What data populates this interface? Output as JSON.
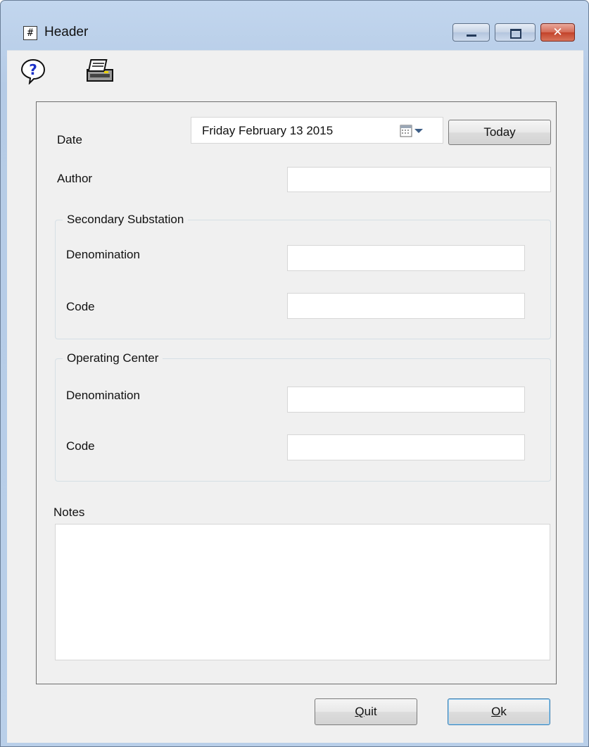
{
  "window": {
    "title": "Header"
  },
  "toolbar": {
    "help_icon": "help-question-icon",
    "print_icon": "printer-icon"
  },
  "form": {
    "date_label": "Date",
    "date_value": "Friday February 13 2015",
    "today_button": "Today",
    "author_label": "Author",
    "author_value": "",
    "secondary_substation": {
      "title": "Secondary Substation",
      "denomination_label": "Denomination",
      "denomination_value": "",
      "code_label": "Code",
      "code_value": ""
    },
    "operating_center": {
      "title": "Operating Center",
      "denomination_label": "Denomination",
      "denomination_value": "",
      "code_label": "Code",
      "code_value": ""
    },
    "notes_label": "Notes",
    "notes_value": ""
  },
  "buttons": {
    "quit_first": "Q",
    "quit_rest": "uit",
    "ok_first": "O",
    "ok_rest": "k"
  },
  "colors": {
    "titlebar": "#b9cfe9",
    "close_button": "#c3432a",
    "client_bg": "#f0f0f0"
  }
}
